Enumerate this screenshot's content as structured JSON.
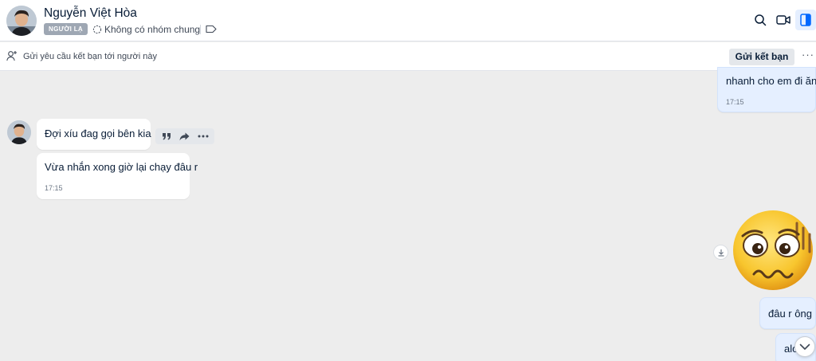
{
  "header": {
    "contact_name": "Nguyễn Việt Hòa",
    "stranger_badge": "NGƯỜI LẠ",
    "group_status": "Không có nhóm chung",
    "icons": [
      "search-icon",
      "video-call-icon",
      "side-panel-icon",
      "tag-icon",
      "group-icon"
    ]
  },
  "friend_bar": {
    "text": "Gửi yêu cầu kết bạn tới người này",
    "button_label": "Gửi kết bạn",
    "more_label": "···"
  },
  "messages": [
    {
      "side": "me",
      "text": "nhanh cho em đi ăn",
      "time": "17:15"
    },
    {
      "side": "other",
      "text": "Đợi xíu đag gọi bên kia",
      "time": ""
    },
    {
      "side": "other",
      "text": "Vừa nhắn xong giờ lại chạy đâu r",
      "time": "17:15"
    },
    {
      "side": "me",
      "type": "sticker",
      "sticker": "worried-face-sticker"
    },
    {
      "side": "me",
      "text": "đâu r ông",
      "time": ""
    },
    {
      "side": "me",
      "text": "alo",
      "time": ""
    }
  ],
  "message_actions": [
    "quote-icon",
    "forward-icon",
    "more-options-icon"
  ],
  "colors": {
    "accent": "#0068ff",
    "my_bubble": "#e5efff",
    "other_bubble": "#ffffff",
    "chat_background": "#ededed",
    "badge": "#9ea7b3"
  }
}
